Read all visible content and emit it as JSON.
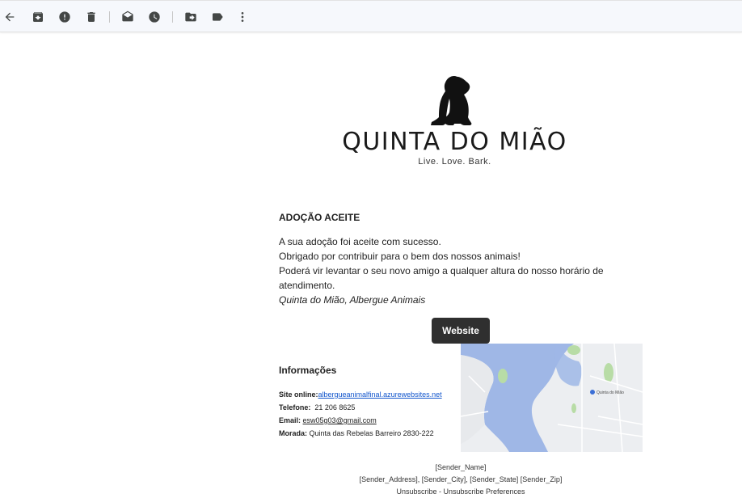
{
  "toolbar": {
    "buttons": [
      {
        "name": "back-icon"
      },
      {
        "name": "archive-icon"
      },
      {
        "name": "report-spam-icon"
      },
      {
        "name": "delete-icon"
      },
      {
        "name": "mark-unread-icon"
      },
      {
        "name": "snooze-icon"
      },
      {
        "name": "move-to-icon"
      },
      {
        "name": "label-icon"
      },
      {
        "name": "more-options-icon"
      }
    ],
    "icon_color": "#444746"
  },
  "logo": {
    "title": "QUINTA DO MIÃO",
    "tagline": "Live. Love. Bark."
  },
  "email": {
    "heading": "ADOÇÃO ACEITE",
    "lines": [
      "A sua adoção foi aceite com sucesso.",
      "Obrigado por contribuir para o bem dos nossos animais!",
      "Poderá vir levantar o seu novo amigo a qualquer altura do nosso horário de",
      "atendimento."
    ],
    "signature": "Quinta do Mião, Albergue Animais",
    "website_button": "Website"
  },
  "info": {
    "heading": "Informações",
    "site_label": "Site online:",
    "site_value": "albergueanimalfinal.azurewebsites.net",
    "phone_label": "Telefone:",
    "phone_value": "21 206 8625",
    "email_label": "Email:",
    "email_value": "esw05g03@gmail.com",
    "address_label": "Morada:",
    "address_value": "Quinta das Rebelas Barreiro 2830-222"
  },
  "map": {
    "water_color": "#9fb7e6",
    "land_color": "#eceef1",
    "park_color": "#b8dca6",
    "place_label": "Quinta do Mião"
  },
  "footer": {
    "sender_name": "[Sender_Name]",
    "sender_address": "[Sender_Address], [Sender_City], [Sender_State] [Sender_Zip]",
    "unsubscribe": "Unsubscribe",
    "separator": " - ",
    "unsubscribe_prefs": "Unsubscribe Preferences"
  }
}
